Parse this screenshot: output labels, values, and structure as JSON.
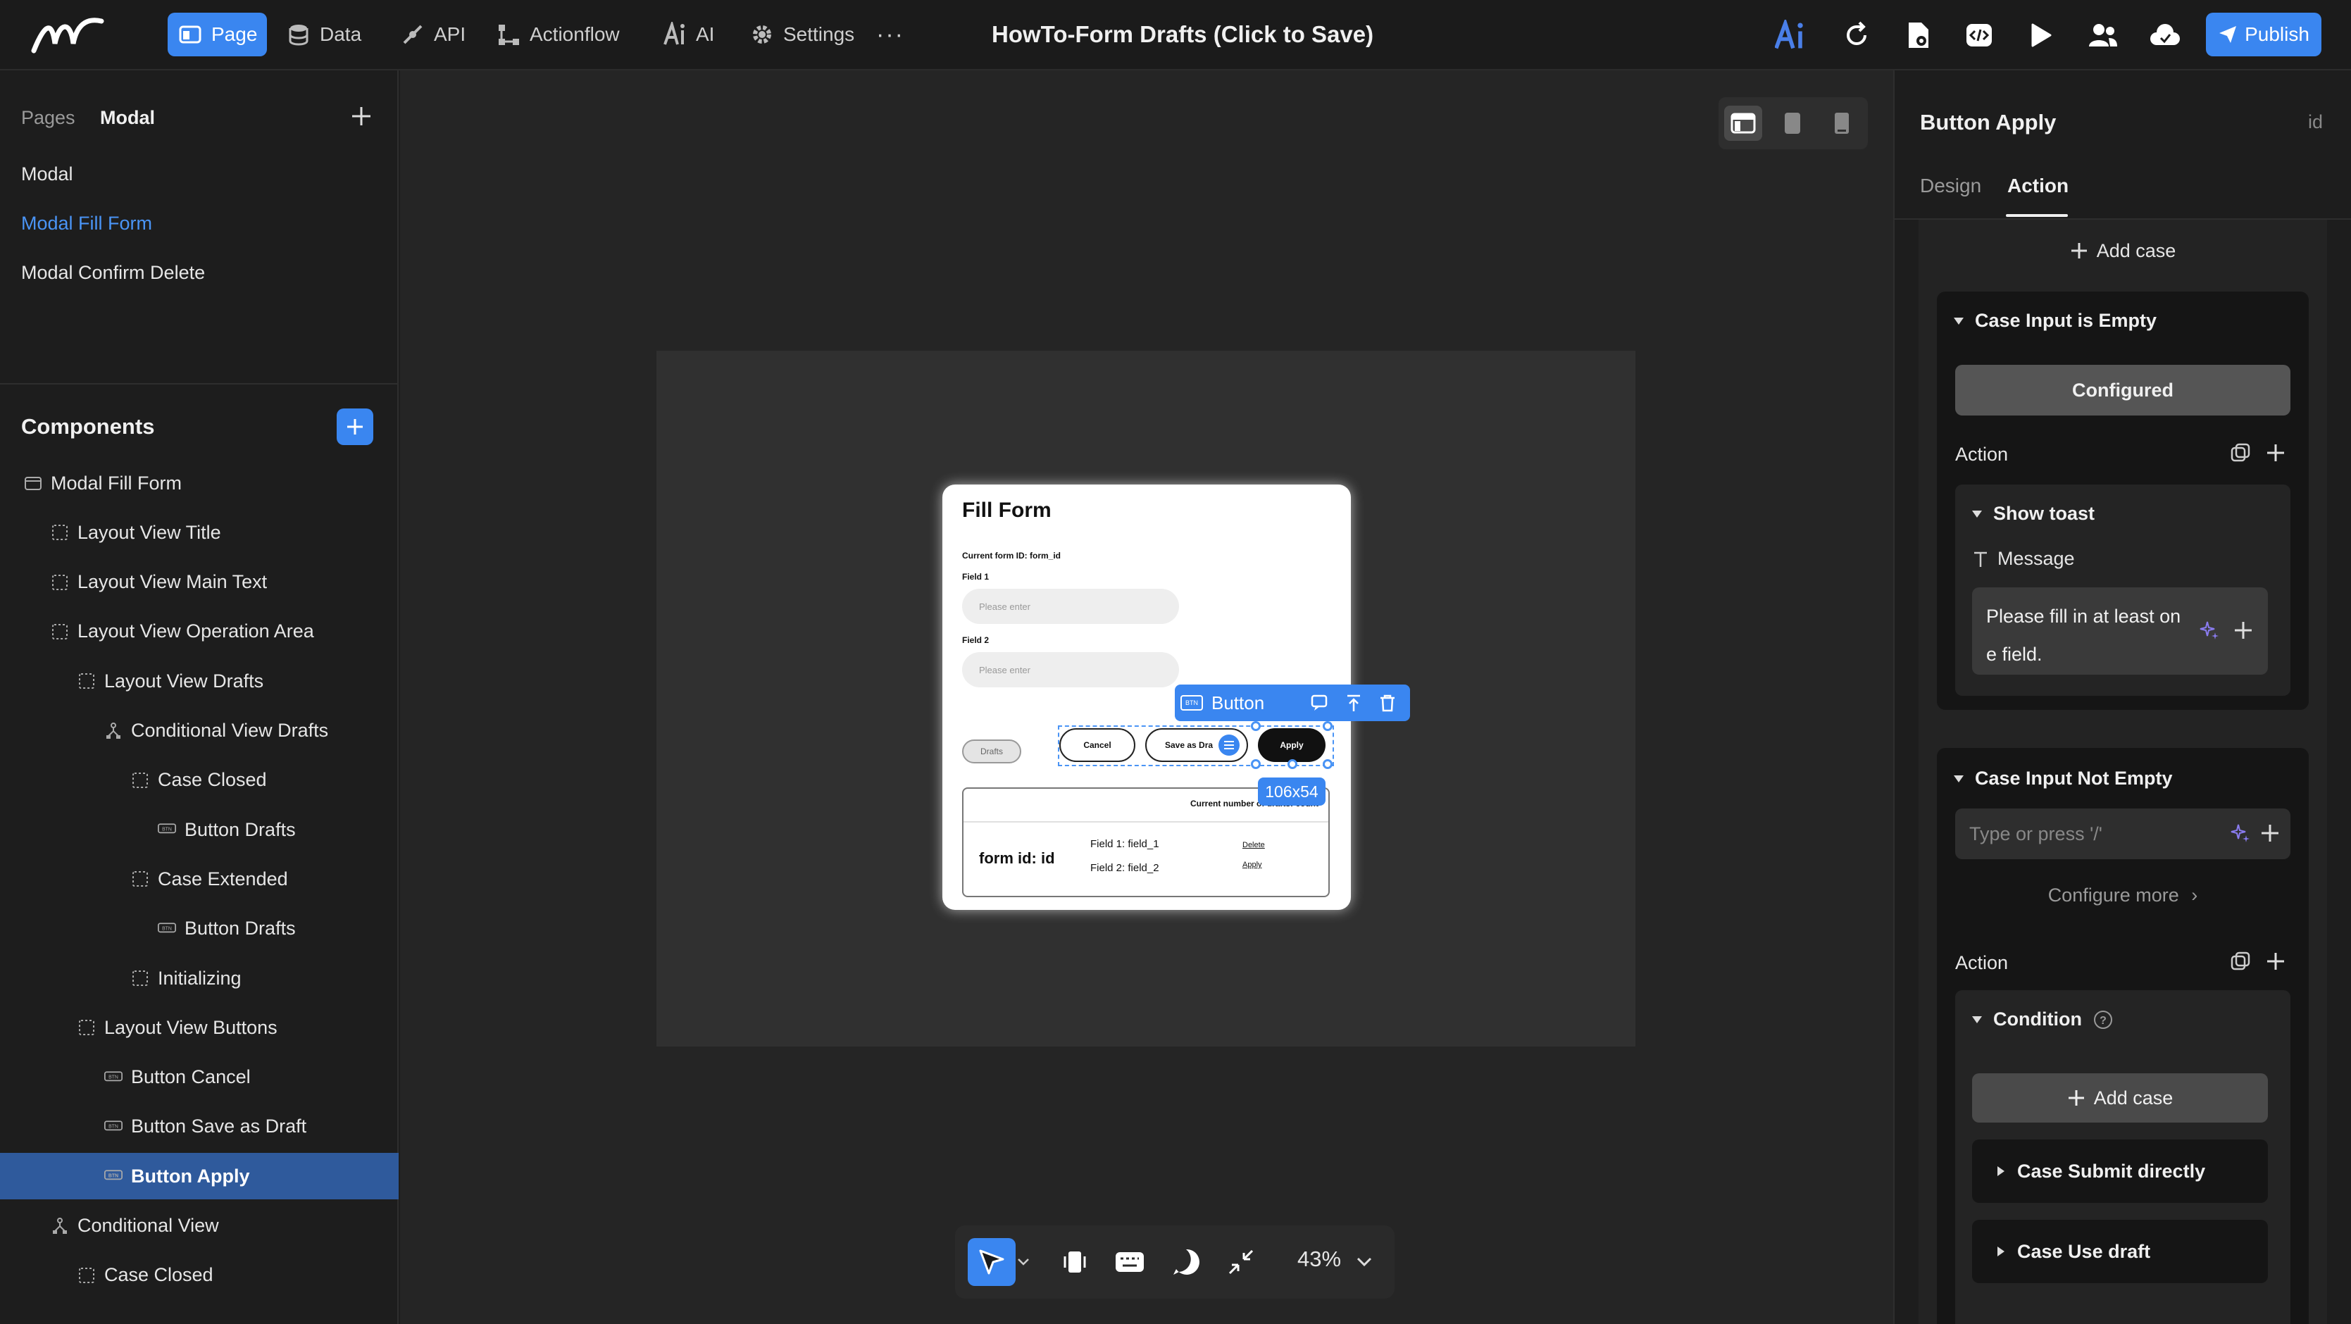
{
  "app": {
    "doc_title": "HowTo-Form Drafts (Click to Save)",
    "publish_label": "Publish",
    "nav": [
      {
        "label": "Page",
        "icon": "page-icon",
        "active": true
      },
      {
        "label": "Data",
        "icon": "database-icon"
      },
      {
        "label": "API",
        "icon": "api-icon"
      },
      {
        "label": "Actionflow",
        "icon": "actionflow-icon"
      },
      {
        "label": "AI",
        "icon": "ai-icon"
      },
      {
        "label": "Settings",
        "icon": "gear-icon"
      }
    ],
    "more_label": "···",
    "accent": "#3a86f0"
  },
  "left": {
    "pages_label": "Pages",
    "modal_label": "Modal",
    "pages": [
      "Modal",
      "Modal Fill Form",
      "Modal Confirm Delete"
    ],
    "components_label": "Components",
    "tree": [
      {
        "label": "Modal Fill Form",
        "icon": "modal-icon",
        "depth": 0
      },
      {
        "label": "Layout View Title",
        "icon": "layout-icon",
        "depth": 1
      },
      {
        "label": "Layout View Main Text",
        "icon": "layout-icon",
        "depth": 1
      },
      {
        "label": "Layout View Operation Area",
        "icon": "layout-icon",
        "depth": 1
      },
      {
        "label": "Layout View Drafts",
        "icon": "layout-icon",
        "depth": 2
      },
      {
        "label": "Conditional View Drafts",
        "icon": "conditional-icon",
        "depth": 3
      },
      {
        "label": "Case Closed",
        "icon": "layout-icon",
        "depth": 4
      },
      {
        "label": "Button Drafts",
        "icon": "button-icon",
        "depth": 5
      },
      {
        "label": "Case Extended",
        "icon": "layout-icon",
        "depth": 4
      },
      {
        "label": "Button Drafts",
        "icon": "button-icon",
        "depth": 5
      },
      {
        "label": "Initializing",
        "icon": "layout-icon",
        "depth": 4
      },
      {
        "label": "Layout View Buttons",
        "icon": "layout-icon",
        "depth": 2
      },
      {
        "label": "Button Cancel",
        "icon": "button-icon",
        "depth": 3
      },
      {
        "label": "Button Save as Draft",
        "icon": "button-icon",
        "depth": 3
      },
      {
        "label": "Button Apply",
        "icon": "button-icon",
        "depth": 3,
        "selected": true
      },
      {
        "label": "Conditional View",
        "icon": "conditional-icon",
        "depth": 1
      },
      {
        "label": "Case Closed",
        "icon": "layout-icon",
        "depth": 2
      }
    ]
  },
  "canvas": {
    "modal": {
      "title": "Fill Form",
      "form_id_text": "Current form ID: form_id",
      "field1_label": "Field 1",
      "field1_placeholder": "Please enter",
      "field2_label": "Field 2",
      "field2_placeholder": "Please enter",
      "drafts_label": "Drafts",
      "cancel_label": "Cancel",
      "save_label": "Save as Dra",
      "apply_label": "Apply",
      "card_header": "Current number of drafts: count",
      "card_form_id": "form id: id",
      "card_field1": "Field 1:  field_1",
      "card_field2": "Field 2: field_2",
      "card_delete": "Delete",
      "card_apply": "Apply"
    },
    "selection_toolbar_label": "Button",
    "selection_tag": "BTN",
    "size_badge": "106x54",
    "zoom": "43%"
  },
  "right": {
    "title": "Button Apply",
    "id_label": "id",
    "tabs": [
      "Design",
      "Action"
    ],
    "add_case_top": "Add case",
    "case1_title": "Case Input is Empty",
    "configured_label": "Configured",
    "action_label": "Action",
    "show_toast_label": "Show toast",
    "message_label": "Message",
    "message_value": "Please fill in at least on e field.",
    "case2_title": "Case Input Not Empty",
    "type_placeholder": "Type or press '/'",
    "configure_more": "Configure more",
    "action_label2": "Action",
    "condition_label": "Condition",
    "add_case_inner": "Add case",
    "case_submit": "Case Submit directly",
    "case_draft": "Case Use draft"
  }
}
